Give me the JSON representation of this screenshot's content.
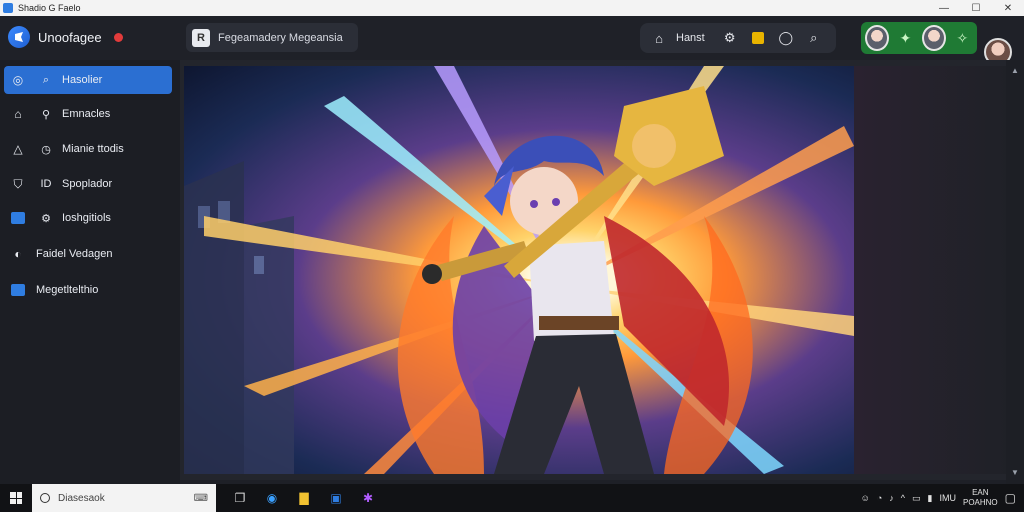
{
  "window": {
    "title": "Shadio G Faelo",
    "minimize": "—",
    "maximize": "☐",
    "close": "✕"
  },
  "header": {
    "brand": "Unoofagee",
    "tab_label": "Fegeamadery  Megeansia",
    "tool_label": "Hanst",
    "colors": {
      "accent": "#2b6fd2",
      "user_group": "#1f7a34",
      "notification": "#e23b3b"
    }
  },
  "sidebar": {
    "items": [
      {
        "label": "Hasolier",
        "icon": "compass-icon",
        "active": true
      },
      {
        "label": "Emnacles",
        "icon": "home-icon",
        "active": false
      },
      {
        "label": "Mianie ttodis",
        "icon": "bell-icon",
        "active": false
      },
      {
        "label": "Spoplador",
        "icon": "shield-icon",
        "active": false
      },
      {
        "label": "Ioshgitiols",
        "icon": "gear-icon",
        "active": false
      },
      {
        "label": "Faidel Vedagen",
        "icon": "moon-icon",
        "active": false
      },
      {
        "label": "Megetltelthio",
        "icon": "monitor-icon",
        "active": false
      }
    ]
  },
  "taskbar": {
    "search_placeholder": "Diasesaok",
    "tray_lang": "IMU",
    "clock_time": "EAN",
    "clock_date": "POAHNO"
  }
}
